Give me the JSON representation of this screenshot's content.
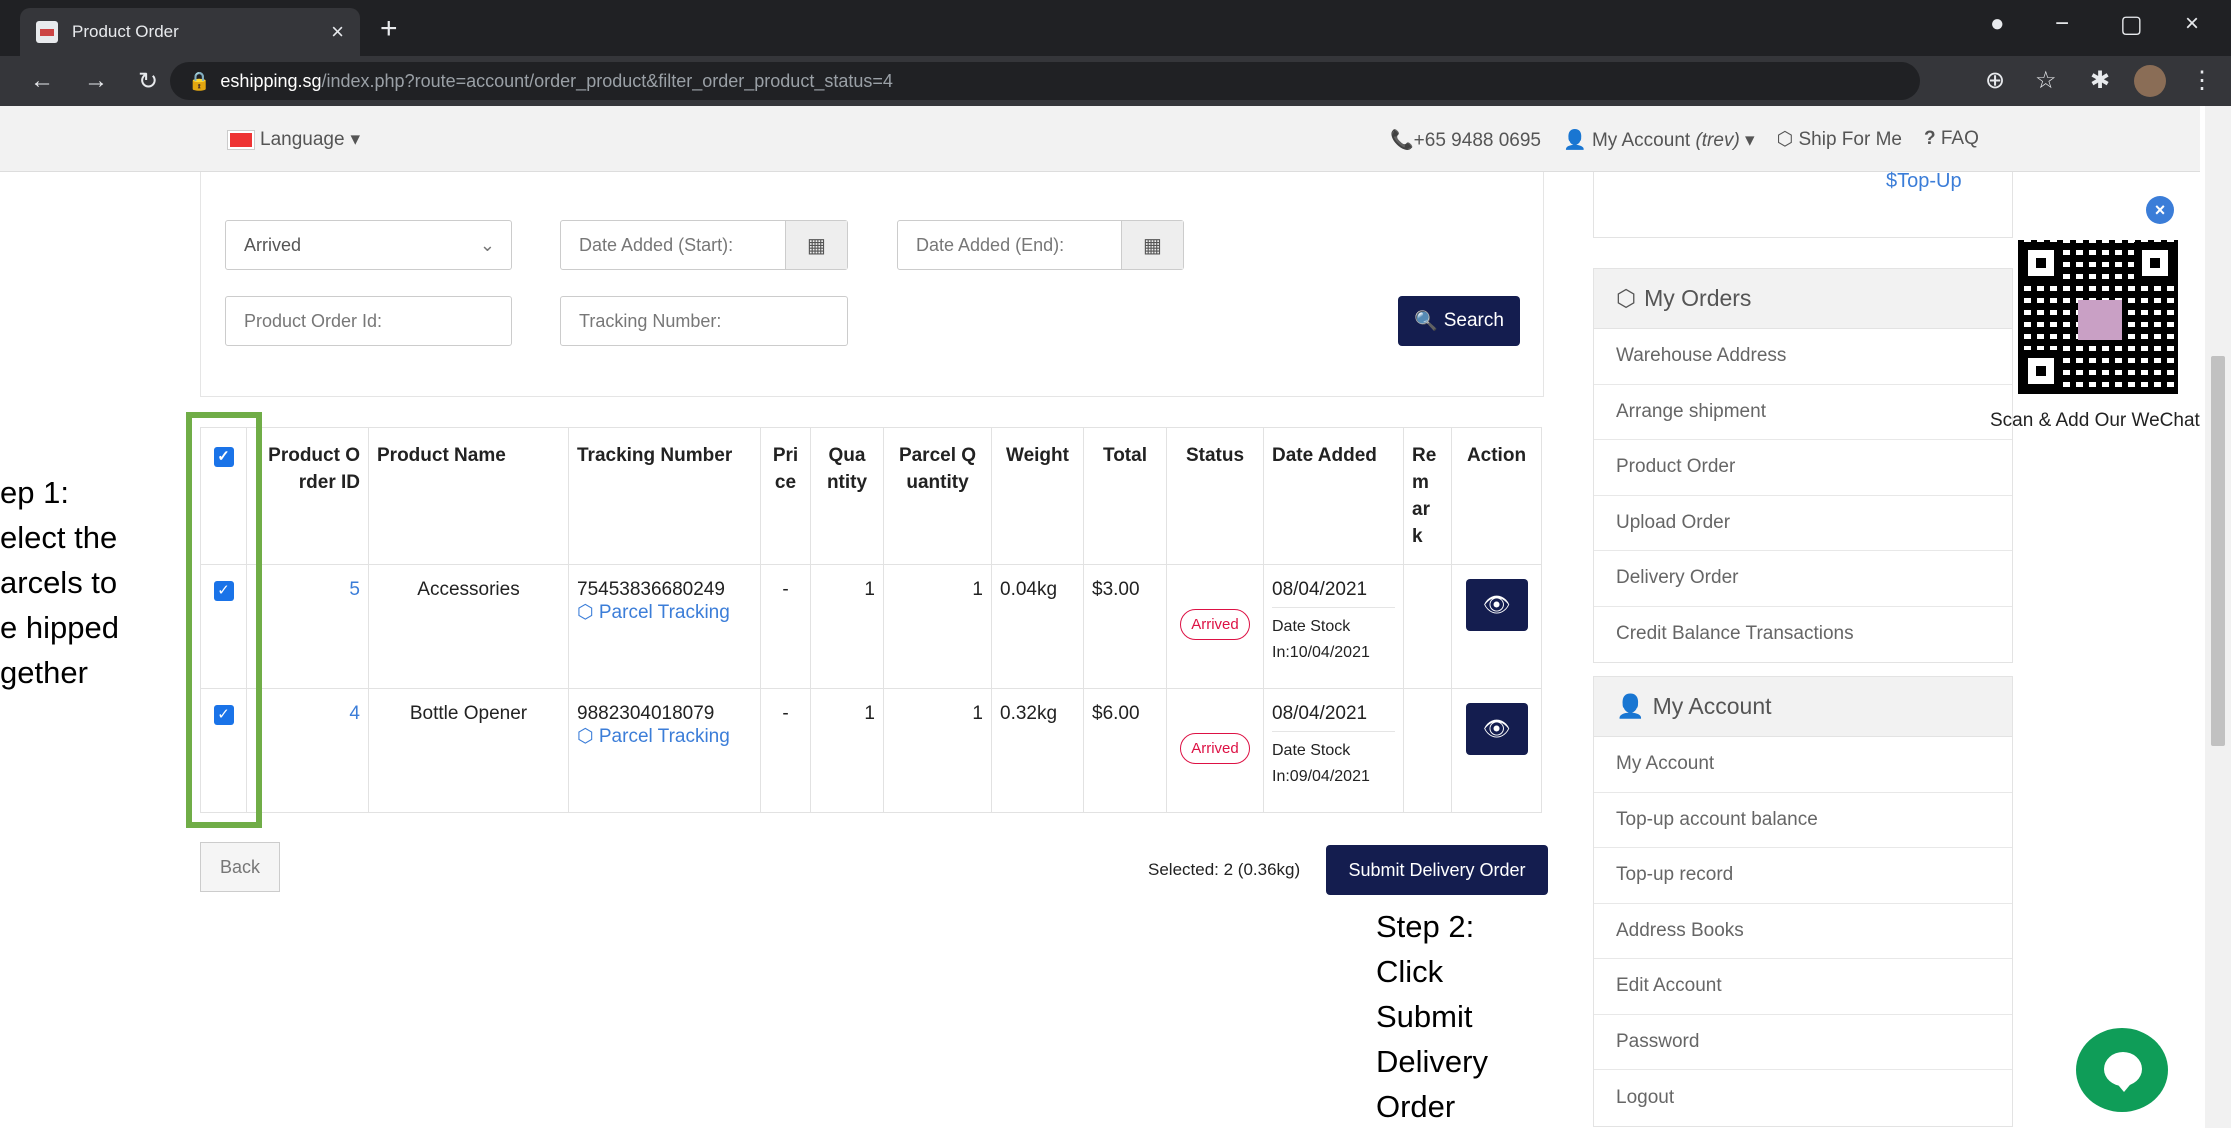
{
  "browser": {
    "tab_title": "Product Order",
    "url_host": "eshipping.sg",
    "url_path": "/index.php?route=account/order_product&filter_order_product_status=4"
  },
  "topbar": {
    "language": "Language",
    "phone": "+65 9488 0695",
    "my_account": "My Account",
    "user": "(trev)",
    "ship_for_me": "Ship For Me",
    "faq": "FAQ"
  },
  "filters": {
    "status_value": "Arrived",
    "date_start_placeholder": "Date Added (Start):",
    "date_end_placeholder": "Date Added (End):",
    "order_id_placeholder": "Product Order Id:",
    "tracking_placeholder": "Tracking Number:",
    "search_label": "Search"
  },
  "table": {
    "headers": [
      "Product O rder ID",
      "Product Name",
      "Tracking Number",
      "Pri ce",
      "Qua ntity",
      "Parcel Q uantity",
      "Weight",
      "Total",
      "Status",
      "Date Added",
      "Re m ar k",
      "Action"
    ],
    "rows": [
      {
        "id": "5",
        "name": "Accessories",
        "tracking": "75453836680249",
        "tracking_link": "Parcel Tracking",
        "price": "-",
        "qty": "1",
        "parcel_qty": "1",
        "weight": "0.04kg",
        "total": "$3.00",
        "status": "Arrived",
        "date": "08/04/2021",
        "stock": "Date Stock In:10/04/2021"
      },
      {
        "id": "4",
        "name": "Bottle Opener",
        "tracking": "9882304018079",
        "tracking_link": "Parcel Tracking",
        "price": "-",
        "qty": "1",
        "parcel_qty": "1",
        "weight": "0.32kg",
        "total": "$6.00",
        "status": "Arrived",
        "date": "08/04/2021",
        "stock": "Date Stock In:09/04/2021"
      }
    ]
  },
  "footer": {
    "back": "Back",
    "selected": "Selected: 2 (0.36kg)",
    "submit": "Submit Delivery Order"
  },
  "annotations": {
    "step1": "ep 1: elect the arcels to e hipped gether",
    "step2": "Step 2: Click Submit Delivery Order"
  },
  "sidebar": {
    "topup": "Top-Up",
    "orders_title": "My Orders",
    "orders": [
      "Warehouse Address",
      "Arrange shipment",
      "Product Order",
      "Upload Order",
      "Delivery Order",
      "Credit Balance Transactions"
    ],
    "account_title": "My Account",
    "account": [
      "My Account",
      "Top-up account balance",
      "Top-up record",
      "Address Books",
      "Edit Account",
      "Password",
      "Logout"
    ]
  },
  "wechat": {
    "caption": "Scan & Add Our WeChat"
  },
  "colors": {
    "primary": "#141d4f",
    "link": "#3b7dd8",
    "status": "#dd1144",
    "highlight": "#70ad47"
  }
}
